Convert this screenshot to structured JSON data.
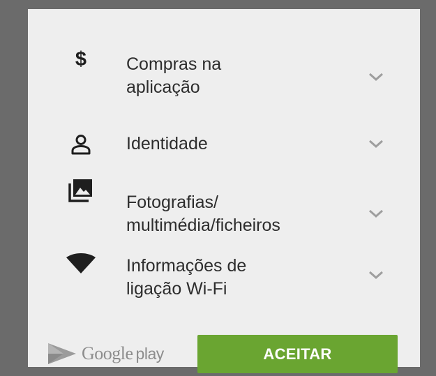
{
  "permissions": [
    {
      "icon": "dollar-icon",
      "label": "Compras na\naplicação",
      "glyph": "$"
    },
    {
      "icon": "person-icon",
      "label": "Identidade"
    },
    {
      "icon": "photos-media-icon",
      "label": "Fotografias/\nmultimédia/ficheiros"
    },
    {
      "icon": "wifi-icon",
      "label": "Informações de\nligação Wi-Fi"
    }
  ],
  "footer": {
    "logo_google": "Google",
    "logo_play": "play",
    "accept_label": "ACEITAR"
  },
  "colors": {
    "backdrop": "#6b6b6b",
    "dialog_bg": "#eeeeee",
    "accent_green": "#6aa531",
    "text": "#2d2d2d",
    "chevron": "#9e9e9e"
  }
}
